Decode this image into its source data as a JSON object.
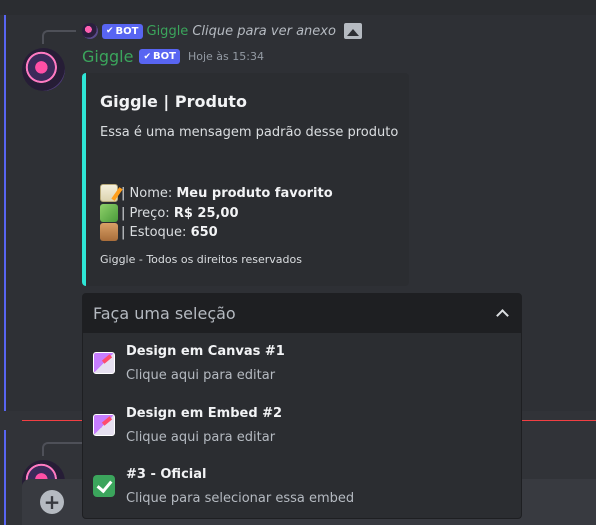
{
  "reply_preview": {
    "bot_tag": "BOT",
    "username": "Giggle",
    "text": "Clique para ver anexo"
  },
  "message": {
    "username": "Giggle",
    "bot_tag": "BOT",
    "timestamp": "Hoje às 15:34",
    "embed": {
      "accent_color": "#2ee6d6",
      "title": "Giggle | Produto",
      "description": "Essa é uma mensagem padrão desse produto",
      "fields": [
        {
          "icon": "memo-icon",
          "label": "| Nome:",
          "value": "Meu produto favorito"
        },
        {
          "icon": "money-icon",
          "label": "| Preço:",
          "value": "R$ 25,00"
        },
        {
          "icon": "package-icon",
          "label": "| Estoque:",
          "value": "650"
        }
      ],
      "footer": "Giggle - Todos os direitos reservados"
    }
  },
  "select_menu": {
    "placeholder": "Faça uma seleção",
    "options": [
      {
        "icon": "canvas-icon",
        "label": "Design em Canvas #1",
        "description": "Clique aqui para editar"
      },
      {
        "icon": "canvas-icon",
        "label": "Design em Embed #2",
        "description": "Clique aqui para editar"
      },
      {
        "icon": "check-icon",
        "label": "#3 - Oficial",
        "description": "Clique para selecionar essa embed"
      }
    ]
  },
  "colors": {
    "bot_name": "#3ba55c",
    "bot_tag": "#5865f2",
    "new_messages_divider": "#f23f43"
  }
}
